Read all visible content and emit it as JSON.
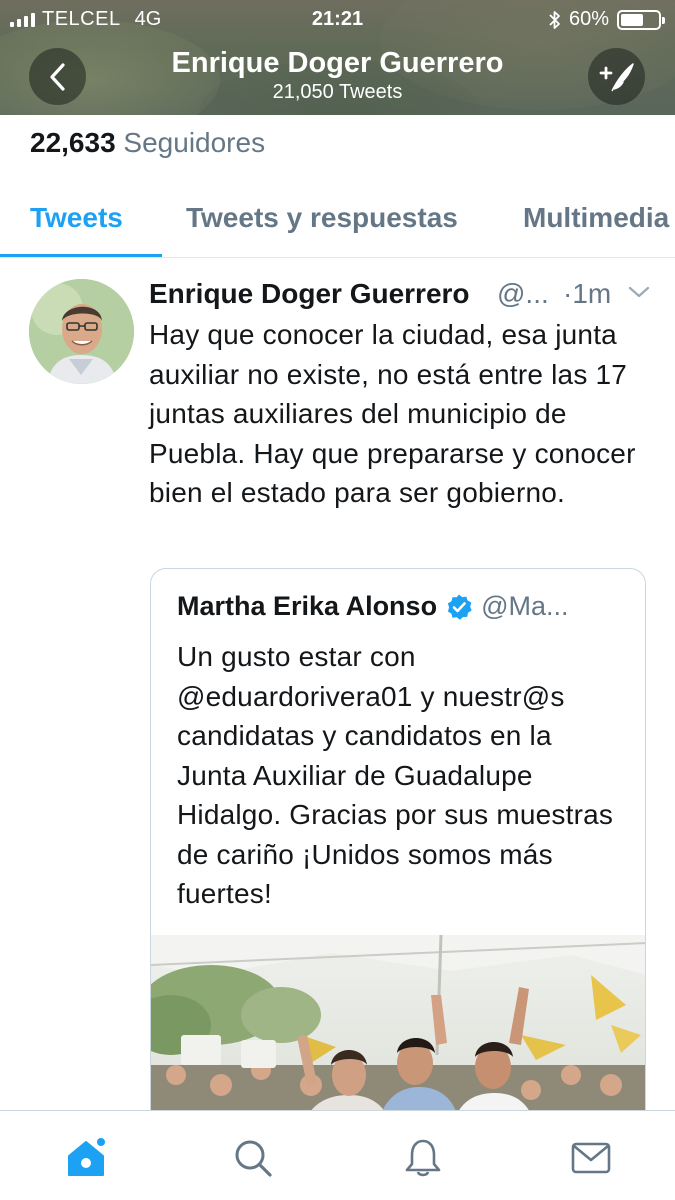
{
  "status_bar": {
    "carrier": "TELCEL",
    "network": "4G",
    "time": "21:21",
    "battery": "60%",
    "battery_level": 0.6
  },
  "header": {
    "title": "Enrique Doger Guerrero",
    "subtitle": "21,050 Tweets",
    "back_icon": "chevron-left-icon",
    "compose_icon": "compose-tweet-icon"
  },
  "profile": {
    "followers_count": "22,633",
    "followers_label": "Seguidores"
  },
  "tabs": [
    {
      "label": "Tweets",
      "active": true
    },
    {
      "label": "Tweets y respuestas",
      "active": false
    },
    {
      "label": "Multimedia",
      "active": false
    }
  ],
  "tweet": {
    "author_name": "Enrique Doger Guerrero",
    "handle": "@...",
    "time": "·1m",
    "text": "Hay que conocer la ciudad, esa junta auxiliar no existe, no está entre las 17 juntas auxiliares del municipio de Puebla. Hay que prepararse y conocer bien el estado para ser gobierno.",
    "quoted": {
      "author_name": "Martha Erika Alonso",
      "verified": true,
      "handle": "@Ma...",
      "text": "Un gusto estar con @eduardorivera01 y nuestr@s candidatas y candidatos en la Junta Auxiliar de Guadalupe Hidalgo. Gracias por sus muestras de cariño ¡Unidos somos más fuertes!"
    }
  },
  "bottom_nav": [
    {
      "name": "home",
      "icon": "home-icon",
      "active": true
    },
    {
      "name": "search",
      "icon": "search-icon",
      "active": false
    },
    {
      "name": "notifications",
      "icon": "bell-icon",
      "active": false
    },
    {
      "name": "messages",
      "icon": "mail-icon",
      "active": false
    }
  ],
  "colors": {
    "accent": "#1da1f2",
    "secondary_text": "#657786",
    "primary_text": "#14171a",
    "border": "#ccd6dd"
  }
}
